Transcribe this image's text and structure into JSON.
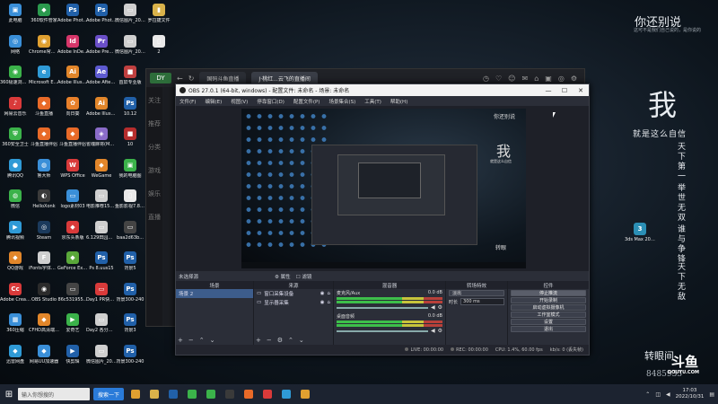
{
  "desktop": {
    "icons": [
      {
        "label": "此电脑",
        "col": 0,
        "row": 0,
        "color": "#3a8fd8",
        "glyph": "▣"
      },
      {
        "label": "360软件管家",
        "col": 1,
        "row": 0,
        "color": "#2b9a4e",
        "glyph": "◆"
      },
      {
        "label": "Adobe Photosh...",
        "col": 2,
        "row": 0,
        "color": "#2160a8",
        "glyph": "Ps"
      },
      {
        "label": "Adobe Photosh...",
        "col": 3,
        "row": 0,
        "color": "#2160a8",
        "glyph": "Ps"
      },
      {
        "label": "微信图片_2022091...",
        "col": 4,
        "row": 0,
        "color": "#cfcfcf",
        "glyph": "▭"
      },
      {
        "label": "罗拉捷文件",
        "col": 5,
        "row": 0,
        "color": "#d9b24a",
        "glyph": "▮"
      },
      {
        "label": "网络",
        "col": 0,
        "row": 1,
        "color": "#3a8fd8",
        "glyph": "◎"
      },
      {
        "label": "Chrome常用浏览器",
        "col": 1,
        "row": 1,
        "color": "#e0a030",
        "glyph": "◉"
      },
      {
        "label": "Adobe InDesi...",
        "col": 2,
        "row": 1,
        "color": "#d6366a",
        "glyph": "Id"
      },
      {
        "label": "Adobe Premie...",
        "col": 3,
        "row": 1,
        "color": "#6a4fc8",
        "glyph": "Pr"
      },
      {
        "label": "微信图片_2022091...",
        "col": 4,
        "row": 1,
        "color": "#cfcfcf",
        "glyph": "▭"
      },
      {
        "label": "2",
        "col": 5,
        "row": 1,
        "color": "#e9e9e9",
        "glyph": "▯"
      },
      {
        "label": "360极速浏览器",
        "col": 0,
        "row": 2,
        "color": "#3bb24a",
        "glyph": "◉"
      },
      {
        "label": "Microsoft Edge",
        "col": 1,
        "row": 2,
        "color": "#2f9ad6",
        "glyph": "e"
      },
      {
        "label": "Adobe Illustrat...",
        "col": 2,
        "row": 2,
        "color": "#e2862a",
        "glyph": "Ai"
      },
      {
        "label": "Adobe After Effects 2020",
        "col": 3,
        "row": 2,
        "color": "#5d5ad0",
        "glyph": "Ae"
      },
      {
        "label": "首屏专业版",
        "col": 4,
        "row": 2,
        "color": "#c04040",
        "glyph": "■"
      },
      {
        "label": "网易云音乐",
        "col": 0,
        "row": 3,
        "color": "#d93a3a",
        "glyph": "♪"
      },
      {
        "label": "斗鱼直播",
        "col": 1,
        "row": 3,
        "color": "#e86a28",
        "glyph": "◆"
      },
      {
        "label": "向日葵",
        "col": 2,
        "row": 3,
        "color": "#e8802a",
        "glyph": "✿"
      },
      {
        "label": "Adobe Illustrat...",
        "col": 3,
        "row": 3,
        "color": "#e2862a",
        "glyph": "Ai"
      },
      {
        "label": "10.12",
        "col": 4,
        "row": 3,
        "color": "#2160a8",
        "glyph": "Ps"
      },
      {
        "label": "360安全卫士",
        "col": 0,
        "row": 4,
        "color": "#3bb24a",
        "glyph": "⛨"
      },
      {
        "label": "斗鱼直播伴侣",
        "col": 1,
        "row": 4,
        "color": "#e86a28",
        "glyph": "◆"
      },
      {
        "label": "斗鱼直播伴侣",
        "col": 2,
        "row": 4,
        "color": "#e86a28",
        "glyph": "◆"
      },
      {
        "label": "雀魂麻将(Mahjong...",
        "col": 3,
        "row": 4,
        "color": "#8a6cc9",
        "glyph": "◈"
      },
      {
        "label": "10",
        "col": 4,
        "row": 4,
        "color": "#b52d2d",
        "glyph": "■"
      },
      {
        "label": "腾讯QQ",
        "col": 0,
        "row": 5,
        "color": "#2f9ad6",
        "glyph": "●"
      },
      {
        "label": "鲁大师",
        "col": 1,
        "row": 5,
        "color": "#3a8fd8",
        "glyph": "◍"
      },
      {
        "label": "WPS Office",
        "col": 2,
        "row": 5,
        "color": "#d93a3a",
        "glyph": "W"
      },
      {
        "label": "WeGame",
        "col": 3,
        "row": 5,
        "color": "#e2862a",
        "glyph": "◆"
      },
      {
        "label": "我的电脑图",
        "col": 4,
        "row": 5,
        "color": "#3bb24a",
        "glyph": "▣"
      },
      {
        "label": "微信",
        "col": 0,
        "row": 6,
        "color": "#3bb24a",
        "glyph": "◍"
      },
      {
        "label": "HelloXonk",
        "col": 1,
        "row": 6,
        "color": "#3a3a3a",
        "glyph": "◐"
      },
      {
        "label": "logo素材03",
        "col": 2,
        "row": 6,
        "color": "#3a8fd8",
        "glyph": "▭"
      },
      {
        "label": "电影推荐15月份屏幕资料",
        "col": 3,
        "row": 6,
        "color": "#cfcfcf",
        "glyph": "▭"
      },
      {
        "label": "鱼影影视7.8.9月文件",
        "col": 4,
        "row": 6,
        "color": "#e9e9e9",
        "glyph": "▯"
      },
      {
        "label": "腾讯视频",
        "col": 0,
        "row": 7,
        "color": "#2f9ad6",
        "glyph": "▶"
      },
      {
        "label": "Steam",
        "col": 1,
        "row": 7,
        "color": "#1b3a5c",
        "glyph": "◎"
      },
      {
        "label": "京东头条版",
        "col": 2,
        "row": 7,
        "color": "#d93a3a",
        "glyph": "◆"
      },
      {
        "label": "6.129田园东方农村直播频道",
        "col": 3,
        "row": 7,
        "color": "#cfcfcf",
        "glyph": "▭"
      },
      {
        "label": "baa2d63b...",
        "col": 4,
        "row": 7,
        "color": "#444",
        "glyph": "▭"
      },
      {
        "label": "QQ游戏",
        "col": 0,
        "row": 8,
        "color": "#e2862a",
        "glyph": "◆"
      },
      {
        "label": "iFonts字体助手",
        "col": 1,
        "row": 8,
        "color": "#cfcfcf",
        "glyph": "F"
      },
      {
        "label": "GeForce Experience",
        "col": 2,
        "row": 8,
        "color": "#5aa83a",
        "glyph": "◆"
      },
      {
        "label": "Ps 8.uus15",
        "col": 3,
        "row": 8,
        "color": "#2160a8",
        "glyph": "Ps"
      },
      {
        "label": "背景5",
        "col": 4,
        "row": 8,
        "color": "#2160a8",
        "glyph": "Ps"
      },
      {
        "label": "Adobe Creati...",
        "col": 0,
        "row": 9,
        "color": "#d93a3a",
        "glyph": "Cc"
      },
      {
        "label": "OBS Studio",
        "col": 1,
        "row": 9,
        "color": "#2b2b2b",
        "glyph": "◉"
      },
      {
        "label": "86c531955...",
        "col": 2,
        "row": 9,
        "color": "#444",
        "glyph": "▭"
      },
      {
        "label": "Day1 PR快捷键大全",
        "col": 3,
        "row": 9,
        "color": "#d93a3a",
        "glyph": "▭"
      },
      {
        "label": "背景300-240",
        "col": 4,
        "row": 9,
        "color": "#2160a8",
        "glyph": "Ps"
      },
      {
        "label": "360压缩",
        "col": 0,
        "row": 10,
        "color": "#3a8fd8",
        "glyph": "▦"
      },
      {
        "label": "CFHD高清端游大全",
        "col": 1,
        "row": 10,
        "color": "#e2862a",
        "glyph": "◆"
      },
      {
        "label": "爱奇艺",
        "col": 2,
        "row": 10,
        "color": "#3bb24a",
        "glyph": "▶"
      },
      {
        "label": "Day2 各分布与画 - 4",
        "col": 3,
        "row": 10,
        "color": "#cfcfcf",
        "glyph": "▭"
      },
      {
        "label": "背景3",
        "col": 4,
        "row": 10,
        "color": "#2160a8",
        "glyph": "Ps"
      },
      {
        "label": "迅雷网盘",
        "col": 0,
        "row": 11,
        "color": "#2f9ad6",
        "glyph": "◆"
      },
      {
        "label": "网易UU加速器",
        "col": 1,
        "row": 11,
        "color": "#3a8fd8",
        "glyph": "◆"
      },
      {
        "label": "快剪辑",
        "col": 2,
        "row": 11,
        "color": "#2160a8",
        "glyph": "▶"
      },
      {
        "label": "微信图片_2022091...",
        "col": 3,
        "row": 11,
        "color": "#cfcfcf",
        "glyph": "▭"
      },
      {
        "label": "背景300-240",
        "col": 4,
        "row": 11,
        "color": "#2160a8",
        "glyph": "Ps"
      }
    ],
    "right_icon_label": "3ds Max 2020 - S...",
    "wallpaper": {
      "top_line": "你还别说",
      "top_sub": "这可不是我们自己说的，是你说的",
      "big_char": "我",
      "mid_line": "就是这么自信",
      "col1": "天下第一",
      "col2": "举世无双",
      "col3": "谁与争锋",
      "col4": "天下无敌",
      "bottom_line": "转眼间",
      "number": "8485935"
    }
  },
  "browser": {
    "tabs": [
      "国码斗鱼直播",
      "J·桃红...云飞的直播间"
    ],
    "toolbar_icons": [
      "◷",
      "♡",
      "☺",
      "✉",
      "⌂",
      "▣",
      "◎",
      "⚙"
    ],
    "side_items": [
      "关注",
      "推荐",
      "分类",
      "游戏",
      "娱乐",
      "直播"
    ]
  },
  "obs": {
    "title": "OBS 27.0.1 (64-bit, windows) - 配置文件: 未命名 - 场景: 未命名",
    "menu": [
      "文件(F)",
      "编辑(E)",
      "视图(V)",
      "停靠窗口(D)",
      "配置文件(P)",
      "场景集合(S)",
      "工具(T)",
      "帮助(H)"
    ],
    "window_controls": [
      "—",
      "☐",
      "✕"
    ],
    "preview_wallpaper": {
      "top": "你还别说",
      "big": "我",
      "sub": "就是这么自信",
      "bottom": "转眼"
    },
    "source_label": "未选择源",
    "props_label": "⚙ 属性",
    "filters_label": "☐ 滤镜",
    "docks": {
      "scenes": {
        "title": "场景",
        "items": [
          "场景 2"
        ]
      },
      "sources": {
        "title": "来源",
        "items": [
          "窗口采集设备",
          "显示器采集"
        ]
      },
      "mixer": {
        "title": "混音器",
        "channels": [
          {
            "name": "麦克风/Aux",
            "db": "0.0 dB"
          },
          {
            "name": "桌面音频",
            "db": "0.0 dB"
          }
        ]
      },
      "transitions": {
        "title": "转场特效",
        "type": "淡出",
        "duration_label": "时长",
        "duration_value": "300 ms"
      },
      "controls": {
        "title": "控件",
        "buttons": [
          "停止推流",
          "开始录制",
          "启动虚拟摄像机",
          "工作室模式",
          "设置",
          "退出"
        ]
      }
    },
    "status": {
      "live": "LIVE: 00:00:00",
      "rec": "REC: 00:00:00",
      "cpu": "CPU: 1.4%, 60.00 fps",
      "kbps": "kb/s: 0 (丢失帧)"
    }
  },
  "taskbar": {
    "start_glyph": "⊞",
    "search_placeholder": "输入你想搜的",
    "search_button": "搜索一下",
    "apps": [
      {
        "name": "chrome",
        "color": "#e0a030"
      },
      {
        "name": "file-explorer",
        "color": "#d9b24a"
      },
      {
        "name": "photoshop",
        "color": "#2160a8"
      },
      {
        "name": "wechat",
        "color": "#3bb24a"
      },
      {
        "name": "wechat-2",
        "color": "#3bb24a"
      },
      {
        "name": "obs",
        "color": "#3a3a3a"
      },
      {
        "name": "douyu",
        "color": "#e86a28"
      },
      {
        "name": "wps",
        "color": "#d93a3a"
      },
      {
        "name": "edge",
        "color": "#2f9ad6"
      },
      {
        "name": "chrome-2",
        "color": "#e0a030"
      }
    ],
    "clock_time": "17:03",
    "clock_date": "2022/10/31"
  },
  "watermark": {
    "text": "斗鱼",
    "sub": "DOUYU.COM"
  }
}
